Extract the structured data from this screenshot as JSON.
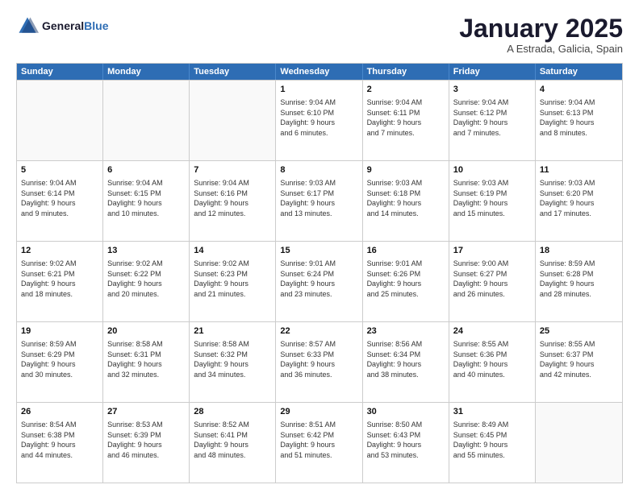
{
  "logo": {
    "line1": "General",
    "line2": "Blue"
  },
  "title": "January 2025",
  "subtitle": "A Estrada, Galicia, Spain",
  "header_days": [
    "Sunday",
    "Monday",
    "Tuesday",
    "Wednesday",
    "Thursday",
    "Friday",
    "Saturday"
  ],
  "weeks": [
    [
      {
        "day": "",
        "text": ""
      },
      {
        "day": "",
        "text": ""
      },
      {
        "day": "",
        "text": ""
      },
      {
        "day": "1",
        "text": "Sunrise: 9:04 AM\nSunset: 6:10 PM\nDaylight: 9 hours\nand 6 minutes."
      },
      {
        "day": "2",
        "text": "Sunrise: 9:04 AM\nSunset: 6:11 PM\nDaylight: 9 hours\nand 7 minutes."
      },
      {
        "day": "3",
        "text": "Sunrise: 9:04 AM\nSunset: 6:12 PM\nDaylight: 9 hours\nand 7 minutes."
      },
      {
        "day": "4",
        "text": "Sunrise: 9:04 AM\nSunset: 6:13 PM\nDaylight: 9 hours\nand 8 minutes."
      }
    ],
    [
      {
        "day": "5",
        "text": "Sunrise: 9:04 AM\nSunset: 6:14 PM\nDaylight: 9 hours\nand 9 minutes."
      },
      {
        "day": "6",
        "text": "Sunrise: 9:04 AM\nSunset: 6:15 PM\nDaylight: 9 hours\nand 10 minutes."
      },
      {
        "day": "7",
        "text": "Sunrise: 9:04 AM\nSunset: 6:16 PM\nDaylight: 9 hours\nand 12 minutes."
      },
      {
        "day": "8",
        "text": "Sunrise: 9:03 AM\nSunset: 6:17 PM\nDaylight: 9 hours\nand 13 minutes."
      },
      {
        "day": "9",
        "text": "Sunrise: 9:03 AM\nSunset: 6:18 PM\nDaylight: 9 hours\nand 14 minutes."
      },
      {
        "day": "10",
        "text": "Sunrise: 9:03 AM\nSunset: 6:19 PM\nDaylight: 9 hours\nand 15 minutes."
      },
      {
        "day": "11",
        "text": "Sunrise: 9:03 AM\nSunset: 6:20 PM\nDaylight: 9 hours\nand 17 minutes."
      }
    ],
    [
      {
        "day": "12",
        "text": "Sunrise: 9:02 AM\nSunset: 6:21 PM\nDaylight: 9 hours\nand 18 minutes."
      },
      {
        "day": "13",
        "text": "Sunrise: 9:02 AM\nSunset: 6:22 PM\nDaylight: 9 hours\nand 20 minutes."
      },
      {
        "day": "14",
        "text": "Sunrise: 9:02 AM\nSunset: 6:23 PM\nDaylight: 9 hours\nand 21 minutes."
      },
      {
        "day": "15",
        "text": "Sunrise: 9:01 AM\nSunset: 6:24 PM\nDaylight: 9 hours\nand 23 minutes."
      },
      {
        "day": "16",
        "text": "Sunrise: 9:01 AM\nSunset: 6:26 PM\nDaylight: 9 hours\nand 25 minutes."
      },
      {
        "day": "17",
        "text": "Sunrise: 9:00 AM\nSunset: 6:27 PM\nDaylight: 9 hours\nand 26 minutes."
      },
      {
        "day": "18",
        "text": "Sunrise: 8:59 AM\nSunset: 6:28 PM\nDaylight: 9 hours\nand 28 minutes."
      }
    ],
    [
      {
        "day": "19",
        "text": "Sunrise: 8:59 AM\nSunset: 6:29 PM\nDaylight: 9 hours\nand 30 minutes."
      },
      {
        "day": "20",
        "text": "Sunrise: 8:58 AM\nSunset: 6:31 PM\nDaylight: 9 hours\nand 32 minutes."
      },
      {
        "day": "21",
        "text": "Sunrise: 8:58 AM\nSunset: 6:32 PM\nDaylight: 9 hours\nand 34 minutes."
      },
      {
        "day": "22",
        "text": "Sunrise: 8:57 AM\nSunset: 6:33 PM\nDaylight: 9 hours\nand 36 minutes."
      },
      {
        "day": "23",
        "text": "Sunrise: 8:56 AM\nSunset: 6:34 PM\nDaylight: 9 hours\nand 38 minutes."
      },
      {
        "day": "24",
        "text": "Sunrise: 8:55 AM\nSunset: 6:36 PM\nDaylight: 9 hours\nand 40 minutes."
      },
      {
        "day": "25",
        "text": "Sunrise: 8:55 AM\nSunset: 6:37 PM\nDaylight: 9 hours\nand 42 minutes."
      }
    ],
    [
      {
        "day": "26",
        "text": "Sunrise: 8:54 AM\nSunset: 6:38 PM\nDaylight: 9 hours\nand 44 minutes."
      },
      {
        "day": "27",
        "text": "Sunrise: 8:53 AM\nSunset: 6:39 PM\nDaylight: 9 hours\nand 46 minutes."
      },
      {
        "day": "28",
        "text": "Sunrise: 8:52 AM\nSunset: 6:41 PM\nDaylight: 9 hours\nand 48 minutes."
      },
      {
        "day": "29",
        "text": "Sunrise: 8:51 AM\nSunset: 6:42 PM\nDaylight: 9 hours\nand 51 minutes."
      },
      {
        "day": "30",
        "text": "Sunrise: 8:50 AM\nSunset: 6:43 PM\nDaylight: 9 hours\nand 53 minutes."
      },
      {
        "day": "31",
        "text": "Sunrise: 8:49 AM\nSunset: 6:45 PM\nDaylight: 9 hours\nand 55 minutes."
      },
      {
        "day": "",
        "text": ""
      }
    ]
  ]
}
